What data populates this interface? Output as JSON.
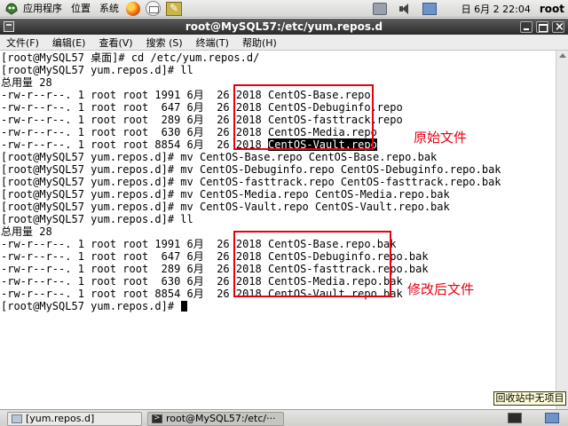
{
  "top_panel": {
    "menus": [
      "应用程序",
      "位置",
      "系统"
    ],
    "date": "日 6月  2 22:04",
    "user": "root"
  },
  "window": {
    "title": "root@MySQL57:/etc/yum.repos.d"
  },
  "menu_bar": [
    "文件(F)",
    "编辑(E)",
    "查看(V)",
    "搜索 (S)",
    "终端(T)",
    "帮助(H)"
  ],
  "terminal": {
    "lines": [
      "[root@MySQL57 桌面]# cd /etc/yum.repos.d/",
      "[root@MySQL57 yum.repos.d]# ll",
      "总用量 28",
      "-rw-r--r--. 1 root root 1991 6月  26 2018 CentOS-Base.repo",
      "-rw-r--r--. 1 root root  647 6月  26 2018 CentOS-Debuginfo.repo",
      "-rw-r--r--. 1 root root  289 6月  26 2018 CentOS-fasttrack.repo",
      "-rw-r--r--. 1 root root  630 6月  26 2018 CentOS-Media.repo",
      "-rw-r--r--. 1 root root 8854 6月  26 2018 ",
      "[root@MySQL57 yum.repos.d]# mv CentOS-Base.repo CentOS-Base.repo.bak",
      "[root@MySQL57 yum.repos.d]# mv CentOS-Debuginfo.repo CentOS-Debuginfo.repo.bak",
      "[root@MySQL57 yum.repos.d]# mv CentOS-fasttrack.repo CentOS-fasttrack.repo.bak",
      "[root@MySQL57 yum.repos.d]# mv CentOS-Media.repo CentOS-Media.repo.bak",
      "[root@MySQL57 yum.repos.d]# mv CentOS-Vault.repo CentOS-Vault.repo.bak",
      "[root@MySQL57 yum.repos.d]# ll",
      "总用量 28",
      "-rw-r--r--. 1 root root 1991 6月  26 2018 CentOS-Base.repo.bak",
      "-rw-r--r--. 1 root root  647 6月  26 2018 CentOS-Debuginfo.repo.bak",
      "-rw-r--r--. 1 root root  289 6月  26 2018 CentOS-fasttrack.repo.bak",
      "-rw-r--r--. 1 root root  630 6月  26 2018 CentOS-Media.repo.bak",
      "-rw-r--r--. 1 root root 8854 6月  26 2018 CentOS-Vault.repo.bak",
      "[root@MySQL57 yum.repos.d]# "
    ],
    "selected_text": "CentOS-Vault.repo",
    "annotation_original": "原始文件",
    "annotation_modified": "修改后文件",
    "highlight_color": "#e60012"
  },
  "tooltip": "回收站中无项目",
  "taskbar": {
    "tasks": [
      "[yum.repos.d]",
      "root@MySQL57:/etc/···"
    ]
  },
  "icons": [
    "applications-icon",
    "firefox-icon",
    "mail-icon",
    "notes-icon",
    "network-icon",
    "volume-icon",
    "display-icon",
    "folder-icon",
    "terminal-icon",
    "show-desktop-icon",
    "workspace-icon"
  ]
}
